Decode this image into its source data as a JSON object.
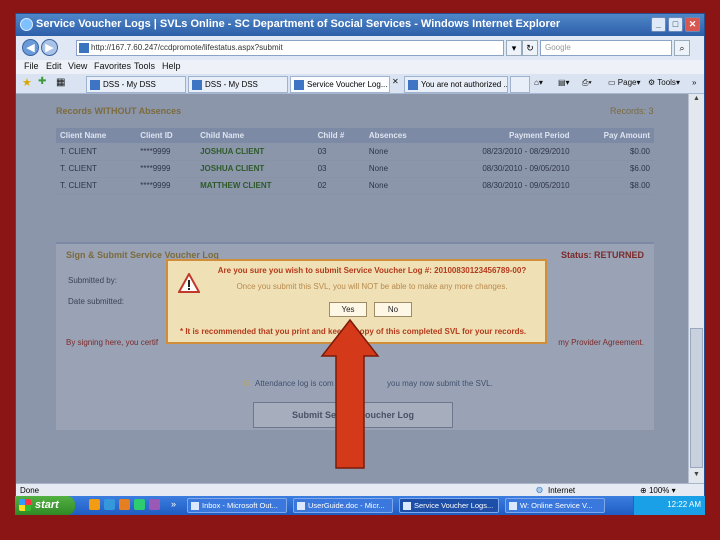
{
  "window": {
    "title": "Service Voucher Logs | SVLs Online - SC Department of Social Services - Windows Internet Explorer",
    "url": "http://167.7.60.247/ccdpromote/lifestatus.aspx?submit",
    "search_placeholder": "Google"
  },
  "menu": [
    "File",
    "Edit",
    "View",
    "Favorites",
    "Tools",
    "Help"
  ],
  "tabs": [
    {
      "label": "DSS - My DSS"
    },
    {
      "label": "DSS - My DSS"
    },
    {
      "label": "Service Voucher Log..."
    },
    {
      "label": "You are not authorized ..."
    }
  ],
  "toolbar_right": {
    "page": "Page",
    "tools": "Tools"
  },
  "records": {
    "heading": "Records WITHOUT Absences",
    "count_label": "Records: 3",
    "columns": [
      "Client Name",
      "Client ID",
      "Child Name",
      "Child #",
      "Absences",
      "Payment Period",
      "Pay Amount"
    ],
    "rows": [
      [
        "T. CLIENT",
        "****9999",
        "JOSHUA CLIENT",
        "03",
        "None",
        "08/23/2010 - 08/29/2010",
        "$0.00"
      ],
      [
        "T. CLIENT",
        "****9999",
        "JOSHUA CLIENT",
        "03",
        "None",
        "08/30/2010 - 09/05/2010",
        "$6.00"
      ],
      [
        "T. CLIENT",
        "****9999",
        "MATTHEW CLIENT",
        "02",
        "None",
        "08/30/2010 - 09/05/2010",
        "$8.00"
      ]
    ]
  },
  "sign": {
    "heading": "Sign & Submit Service Voucher Log",
    "status": "Status: RETURNED",
    "submitted_by": "Submitted by:",
    "date_submitted": "Date submitted:",
    "certify_left": "By signing here, you certif",
    "certify_right": "my Provider Agreement.",
    "attendance_left": "Attendance log is com",
    "attendance_right": "you may now submit the SVL.",
    "submit_label_left": "Submit Serv",
    "submit_label_right": "oucher Log"
  },
  "dialog": {
    "question": "Are you sure you wish to submit Service Voucher Log #: 20100830123456789-00?",
    "message": "Once you submit this SVL, you will NOT be able to make any more changes.",
    "yes": "Yes",
    "no": "No",
    "note": "* It is recommended that you print and keep a copy of this completed SVL for your records."
  },
  "statusbar": {
    "left": "Done",
    "zone": "Internet",
    "zoom": "100%"
  },
  "taskbar": {
    "start": "start",
    "items": [
      "Inbox - Microsoft Out...",
      "UserGuide.doc - Micr...",
      "Service Voucher Logs...",
      "W: Online Service V..."
    ],
    "clock": "12:22 AM"
  },
  "colors": {
    "arrow": "#d43a1a",
    "background": "#8b1414"
  }
}
